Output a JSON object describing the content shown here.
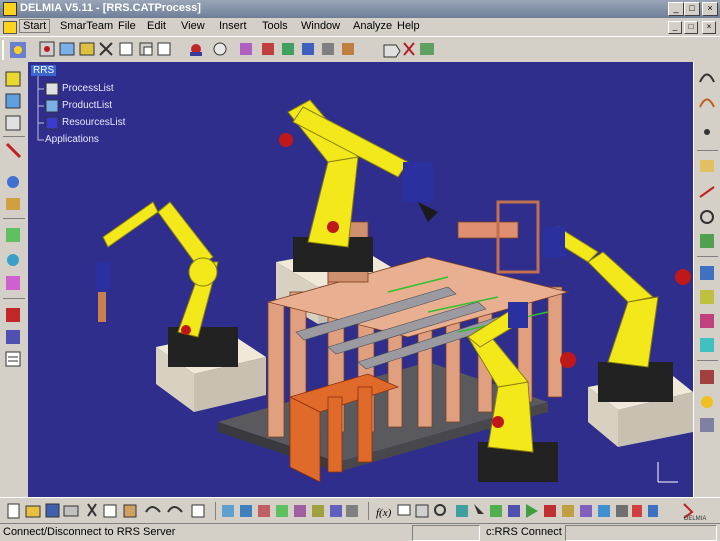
{
  "window": {
    "title": "DELMIA V5.11 - [RRS.CATProcess]",
    "controls": [
      "_",
      "□",
      "×"
    ]
  },
  "menu": {
    "items": [
      "Start",
      "SmarTeam",
      "File",
      "Edit",
      "View",
      "Insert",
      "Tools",
      "Window",
      "Analyze",
      "Help"
    ],
    "active_index": 0
  },
  "tree": {
    "root": "RRS",
    "children": [
      "ProcessList",
      "ProductList",
      "ResourcesList"
    ],
    "applications": "Applications"
  },
  "status": {
    "left": "Connect/Disconnect to RRS Server",
    "right_field": "c:RRS Connect"
  },
  "colors": {
    "viewport_bg": "#2f2e8c",
    "robot_yellow": "#f2e81a",
    "fixture_salmon": "#e0a080",
    "fixture_orange": "#e06a2a",
    "chrome": "#d4d0c8"
  },
  "icons": {
    "top_toolbar": [
      "workbench-icon",
      "new-process-icon",
      "insert-product-icon",
      "insert-resource-icon",
      "process-icon",
      "activity-icon",
      "frame-icon",
      "move-icon",
      "snap-icon",
      "compass-icon",
      "rotate-icon",
      "measure-icon",
      "sequence-icon",
      "link-icon",
      "connect-icon",
      "tool-icon",
      "tag-icon"
    ],
    "left_toolbar": [
      "robot-jog-icon",
      "teach-icon",
      "motion-icon",
      "path-icon",
      "target-icon",
      "gun-icon",
      "home-icon",
      "device-icon",
      "kinematics-icon",
      "collision-icon",
      "clash-icon",
      "list-icon"
    ],
    "right_toolbar": [
      "spline-icon",
      "curve-icon",
      "point-icon",
      "plane-icon",
      "axis-icon",
      "rotate-view-icon",
      "zoom-icon",
      "pan-icon",
      "fly-icon",
      "walk-icon",
      "normal-view-icon",
      "render-icon",
      "sun-icon",
      "fog-icon"
    ],
    "bottom_toolbar": [
      "new-file-icon",
      "open-file-icon",
      "save-icon",
      "print-icon",
      "cut-icon",
      "copy-icon",
      "paste-icon",
      "undo-icon",
      "redo-icon",
      "help-icon",
      "fit-all-icon",
      "zoom-area-icon",
      "pan-view-icon",
      "rotate-view2-icon",
      "zoom-in-icon",
      "zoom-out-icon",
      "normal-icon",
      "view-mode-icon",
      "formula-icon",
      "comment-icon",
      "publish-icon",
      "search-icon",
      "graph-icon",
      "select-icon",
      "group-icon",
      "ungroup-icon",
      "sim-play-icon",
      "sim-stop-icon",
      "clash-detect-icon",
      "distance-icon",
      "section-icon",
      "shade-icon",
      "color-icon",
      "cylinder-icon",
      "delmia-logo-icon"
    ]
  }
}
